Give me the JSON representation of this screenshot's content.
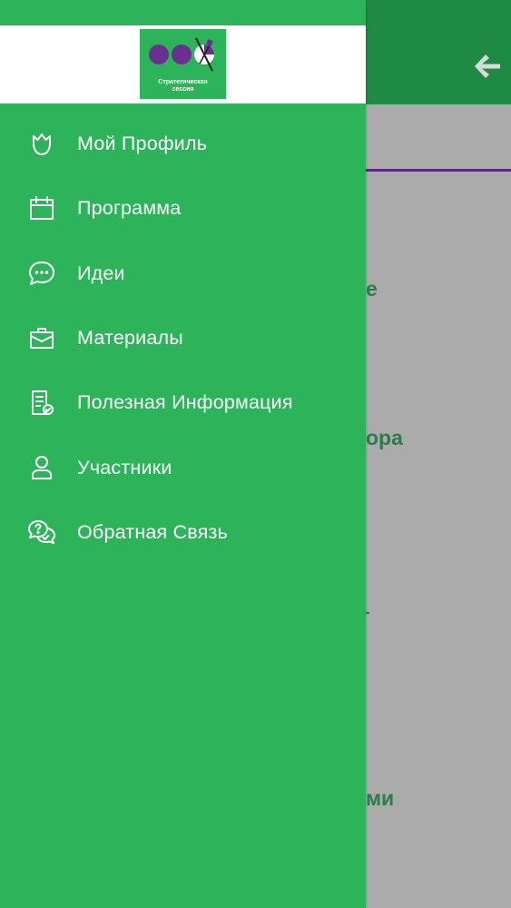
{
  "colors": {
    "drawer_bg": "#2db35a",
    "header_bg": "#1f8a43",
    "accent_purple": "#5b2a7e",
    "overlay_bg": "#ababab",
    "text_white": "#ffffff"
  },
  "logo": {
    "line1": "Стратегическая",
    "line2": "сессия"
  },
  "menu": {
    "items": [
      {
        "label": "Мой Профиль",
        "icon": "user-crown-icon"
      },
      {
        "label": "Программа",
        "icon": "calendar-icon"
      },
      {
        "label": "Идеи",
        "icon": "chat-dots-icon"
      },
      {
        "label": "Материалы",
        "icon": "briefcase-icon"
      },
      {
        "label": "Полезная Информация",
        "icon": "document-check-icon"
      },
      {
        "label": "Участники",
        "icon": "person-icon"
      },
      {
        "label": "Обратная Связь",
        "icon": "feedback-chat-icon"
      }
    ]
  },
  "background": {
    "fragments": [
      "е",
      "ора",
      "ми"
    ]
  }
}
